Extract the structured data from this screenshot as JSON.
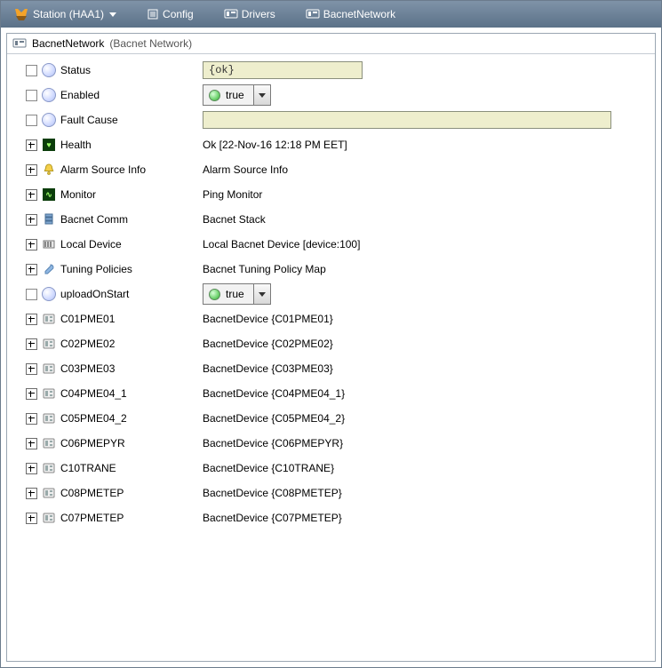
{
  "breadcrumb": {
    "station_label": "Station (HAA1)",
    "config_label": "Config",
    "drivers_label": "Drivers",
    "bacnet_label": "BacnetNetwork"
  },
  "header": {
    "name": "BacnetNetwork",
    "type": "(Bacnet Network)"
  },
  "props": {
    "status": {
      "label": "Status",
      "value": "{ok}"
    },
    "enabled": {
      "label": "Enabled",
      "value": "true"
    },
    "faultCause": {
      "label": "Fault Cause",
      "value": ""
    },
    "health": {
      "label": "Health",
      "value": "Ok [22-Nov-16 12:18 PM EET]"
    },
    "alarmSrc": {
      "label": "Alarm Source Info",
      "value": "Alarm Source Info"
    },
    "monitor": {
      "label": "Monitor",
      "value": "Ping Monitor"
    },
    "bacnetComm": {
      "label": "Bacnet Comm",
      "value": "Bacnet Stack"
    },
    "localDevice": {
      "label": "Local Device",
      "value": "Local Bacnet Device [device:100]"
    },
    "tuning": {
      "label": "Tuning Policies",
      "value": "Bacnet Tuning Policy Map"
    },
    "uploadOnStart": {
      "label": "uploadOnStart",
      "value": "true"
    }
  },
  "devices": [
    {
      "name": "C01PME01",
      "desc": "BacnetDevice {C01PME01}"
    },
    {
      "name": "C02PME02",
      "desc": "BacnetDevice {C02PME02}"
    },
    {
      "name": "C03PME03",
      "desc": "BacnetDevice {C03PME03}"
    },
    {
      "name": "C04PME04_1",
      "desc": "BacnetDevice {C04PME04_1}"
    },
    {
      "name": "C05PME04_2",
      "desc": "BacnetDevice {C05PME04_2}"
    },
    {
      "name": "C06PMEPYR",
      "desc": "BacnetDevice {C06PMEPYR}"
    },
    {
      "name": "C10TRANE",
      "desc": "BacnetDevice {C10TRANE}"
    },
    {
      "name": "C08PMETEP",
      "desc": "BacnetDevice {C08PMETEP}"
    },
    {
      "name": "C07PMETEP",
      "desc": "BacnetDevice {C07PMETEP}"
    }
  ]
}
